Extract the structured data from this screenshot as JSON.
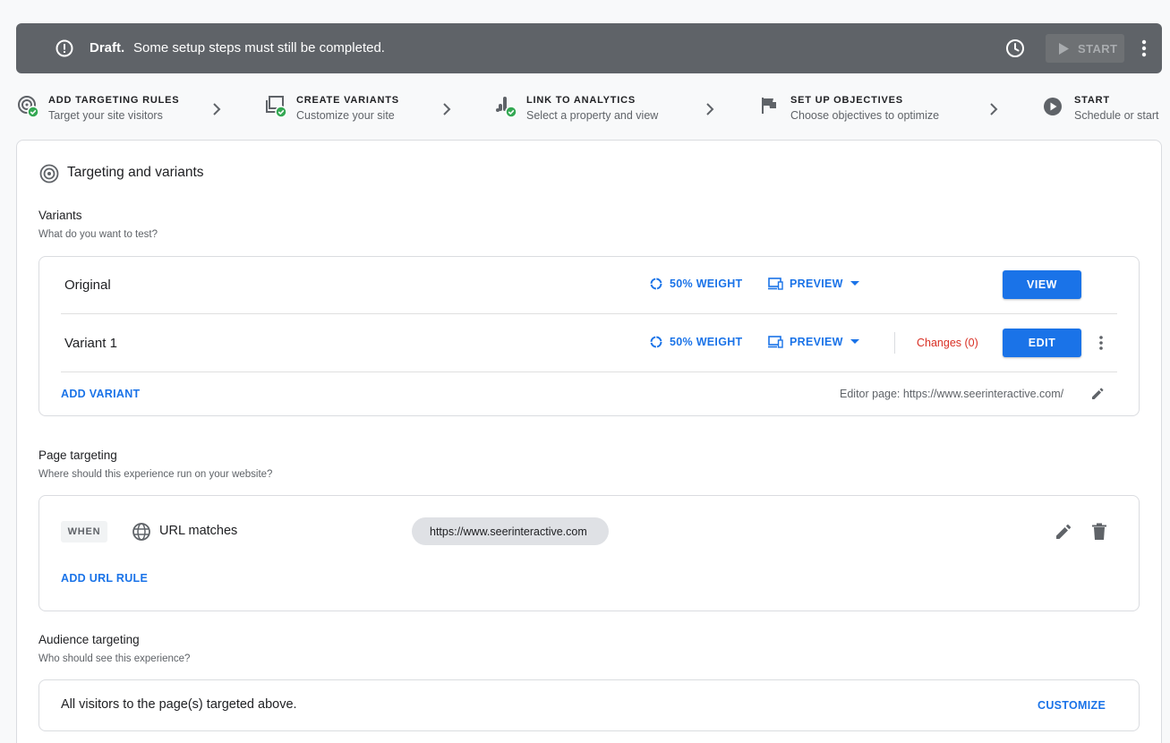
{
  "banner": {
    "status": "Draft.",
    "message": "Some setup steps must still be completed.",
    "start_label": "START"
  },
  "steps": [
    {
      "title": "ADD TARGETING RULES",
      "subtitle": "Target your site visitors",
      "completed": true
    },
    {
      "title": "CREATE VARIANTS",
      "subtitle": "Customize your site",
      "completed": true
    },
    {
      "title": "LINK TO ANALYTICS",
      "subtitle": "Select a property and view",
      "completed": true
    },
    {
      "title": "SET UP OBJECTIVES",
      "subtitle": "Choose objectives to optimize",
      "completed": false
    },
    {
      "title": "START",
      "subtitle": "Schedule or start",
      "completed": false
    }
  ],
  "card": {
    "title": "Targeting and variants"
  },
  "variants": {
    "title": "Variants",
    "subtitle": "What do you want to test?",
    "rows": [
      {
        "name": "Original",
        "weight": "50% WEIGHT",
        "preview": "PREVIEW",
        "action": "VIEW"
      },
      {
        "name": "Variant 1",
        "weight": "50% WEIGHT",
        "preview": "PREVIEW",
        "changes": "Changes (0)",
        "action": "EDIT"
      }
    ],
    "add_label": "ADD VARIANT",
    "editor_page": "Editor page: https://www.seerinteractive.com/"
  },
  "page_targeting": {
    "title": "Page targeting",
    "subtitle": "Where should this experience run on your website?",
    "when_label": "WHEN",
    "condition": "URL matches",
    "url": "https://www.seerinteractive.com",
    "add_label": "ADD URL RULE"
  },
  "audience": {
    "title": "Audience targeting",
    "subtitle": "Who should see this experience?",
    "text": "All visitors to the page(s) targeted above.",
    "customize_label": "CUSTOMIZE"
  },
  "colors": {
    "primary": "#1a73e8",
    "banner": "#5f6368",
    "success": "#34a853",
    "error": "#d93025"
  }
}
